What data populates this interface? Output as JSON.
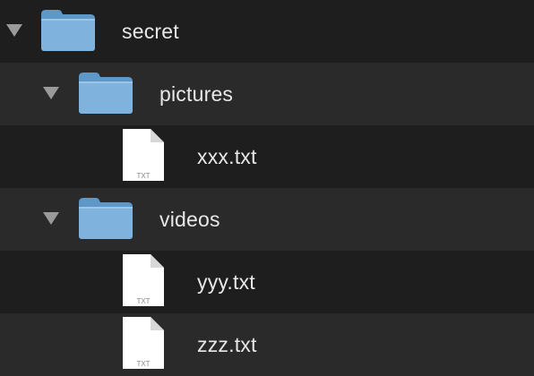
{
  "tree": {
    "rows": [
      {
        "kind": "folder",
        "label": "secret",
        "expanded": true,
        "icon": "folder-icon"
      },
      {
        "kind": "folder",
        "label": "pictures",
        "expanded": true,
        "icon": "folder-icon"
      },
      {
        "kind": "file",
        "label": "xxx.txt",
        "badge": "TXT",
        "icon": "text-file-icon"
      },
      {
        "kind": "folder",
        "label": "videos",
        "expanded": true,
        "icon": "folder-icon"
      },
      {
        "kind": "file",
        "label": "yyy.txt",
        "badge": "TXT",
        "icon": "text-file-icon"
      },
      {
        "kind": "file",
        "label": "zzz.txt",
        "badge": "TXT",
        "icon": "text-file-icon"
      }
    ]
  },
  "colors": {
    "background_dark": "#1e1e1e",
    "background_stripe": "#2a2a2a",
    "folder_blue": "#7fb3dd",
    "text": "#e8e8e8",
    "disclosure": "#9a9a9a"
  }
}
